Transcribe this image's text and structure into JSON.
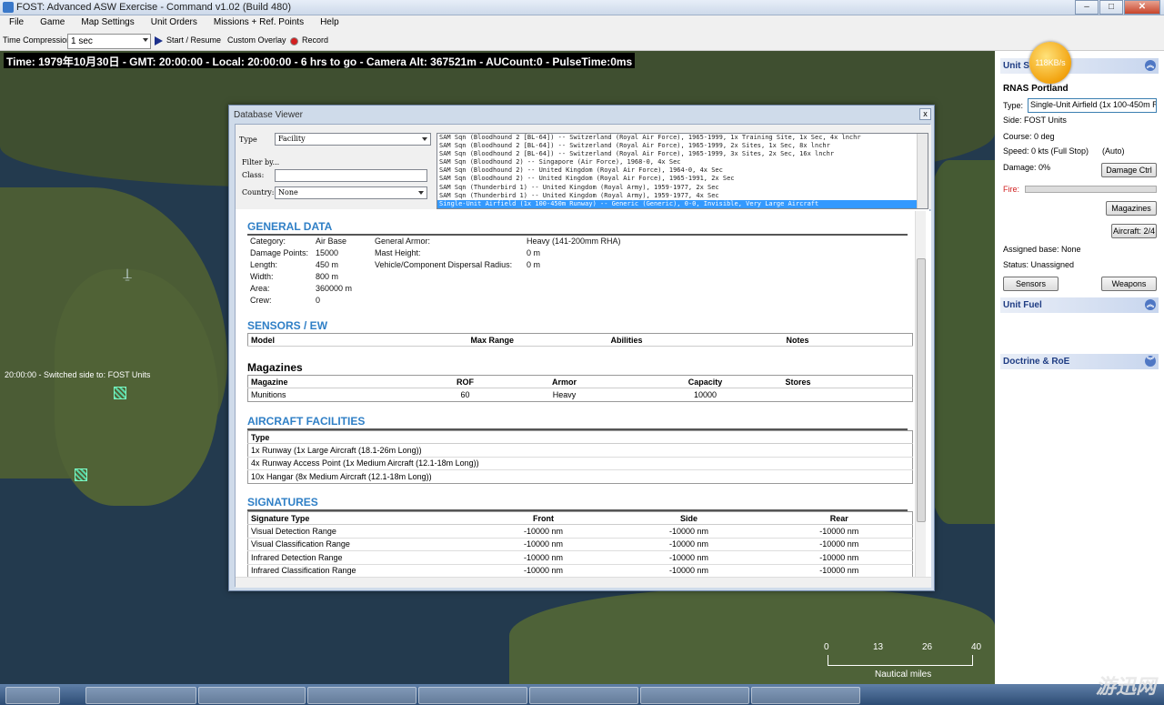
{
  "window": {
    "title": "FOST: Advanced ASW Exercise - Command v1.02 (Build 480)"
  },
  "menu": [
    "File",
    "Game",
    "Map Settings",
    "Unit Orders",
    "Missions + Ref. Points",
    "Help"
  ],
  "toolbar": {
    "time_compression_label": "Time Compression:",
    "time_compression_value": "1 sec",
    "start_label": "Start / Resume",
    "custom_overlay_label": "Custom Overlay",
    "record_label": "Record"
  },
  "map": {
    "status_line": "Time: 1979年10月30日 - GMT: 20:00:00 - Local: 20:00:00 - 6 hrs  to go -  Camera Alt: 367521m - AUCount:0 - PulseTime:0ms",
    "message": "20:00:00 - Switched side to: FOST Units",
    "scale": {
      "ticks": [
        "0",
        "13",
        "26",
        "40"
      ],
      "unit": "Nautical miles"
    }
  },
  "unit_panel": {
    "header": "Unit S",
    "badge": "118KB/s",
    "unit_name": "RNAS Portland",
    "type_label": "Type:",
    "type_value": "Single-Unit Airfield (1x 100-450m Run",
    "side": "Side: FOST Units",
    "course": "Course: 0 deg",
    "speed": "Speed: 0 kts (Full Stop)",
    "speed_mode": "(Auto)",
    "damage": "Damage: 0%",
    "damage_ctrl_btn": "Damage Ctrl",
    "fire_label": "Fire:",
    "magazines_btn": "Magazines",
    "aircraft_btn": "Aircraft: 2/4",
    "assigned_base": "Assigned base: None",
    "status": "Status: Unassigned",
    "sensors_btn": "Sensors",
    "weapons_btn": "Weapons",
    "fuel_header": "Unit Fuel",
    "doctrine_header": "Doctrine & RoE"
  },
  "db_viewer": {
    "title": "Database Viewer",
    "close": "x",
    "type_label": "Type",
    "type_value": "Facility",
    "filter_label": "Filter by...",
    "class_label": "Class:",
    "class_value": "",
    "country_label": "Country:",
    "country_value": "None",
    "results": [
      "SAM Sqn (Bloodhound 2 [BL-64]) -- Switzerland (Royal Air Force), 1965-1999, 1x Training Site, 1x Sec, 4x lnchr",
      "SAM Sqn (Bloodhound 2 [BL-64]) -- Switzerland (Royal Air Force), 1965-1999, 2x Sites, 1x Sec, 8x lnchr",
      "SAM Sqn (Bloodhound 2 [BL-64]) -- Switzerland (Royal Air Force), 1965-1999, 3x Sites, 2x Sec, 16x lnchr",
      "SAM Sqn (Bloodhound 2) -- Singapore (Air Force), 1968-0, 4x Sec",
      "SAM Sqn (Bloodhound 2) -- United Kingdom (Royal Air Force), 1964-0, 4x Sec",
      "SAM Sqn (Bloodhound 2) -- United Kingdom (Royal Air Force), 1965-1991, 2x Sec",
      "SAM Sqn (Thunderbird 1) -- United Kingdom (Royal Army), 1959-1977, 2x Sec",
      "SAM Sqn (Thunderbird 1) -- United Kingdom (Royal Army), 1959-1977, 4x Sec",
      "Single-Unit Airfield (1x 100-450m Runway) -- Generic (Generic), 0-0, Invisible, Very Large Aircraft"
    ],
    "general": {
      "header": "GENERAL DATA",
      "left": [
        {
          "k": "Category:",
          "v": "Air Base"
        },
        {
          "k": "Damage Points:",
          "v": "15000"
        },
        {
          "k": "Length:",
          "v": "450 m"
        },
        {
          "k": "Width:",
          "v": "800 m"
        },
        {
          "k": "Area:",
          "v": "360000 m"
        },
        {
          "k": "Crew:",
          "v": "0"
        }
      ],
      "right": [
        {
          "k": "General Armor:",
          "v": "Heavy (141-200mm RHA)"
        },
        {
          "k": "Mast Height:",
          "v": "0 m"
        },
        {
          "k": "Vehicle/Component Dispersal Radius:",
          "v": "0 m"
        }
      ]
    },
    "sensors": {
      "header": "SENSORS / EW",
      "cols": [
        "Model",
        "Max Range",
        "Abilities",
        "Notes"
      ]
    },
    "magazines": {
      "header": "Magazines",
      "cols": [
        "Magazine",
        "ROF",
        "Armor",
        "Capacity",
        "Stores"
      ],
      "rows": [
        [
          "Munitions",
          "60",
          "Heavy",
          "10000",
          ""
        ]
      ]
    },
    "aircraft": {
      "header": "AIRCRAFT FACILITIES",
      "cols": [
        "Type"
      ],
      "rows": [
        "1x Runway (1x Large Aircraft (18.1-26m Long))",
        "4x Runway Access Point (1x Medium Aircraft (12.1-18m Long))",
        "10x Hangar (8x Medium Aircraft (12.1-18m Long))"
      ]
    },
    "signatures": {
      "header": "SIGNATURES",
      "cols": [
        "Signature Type",
        "Front",
        "Side",
        "Rear"
      ],
      "rows": [
        [
          "Visual Detection Range",
          "-10000 nm",
          "-10000 nm",
          "-10000 nm"
        ],
        [
          "Visual Classification Range",
          "-10000 nm",
          "-10000 nm",
          "-10000 nm"
        ],
        [
          "Infrared Detection Range",
          "-10000 nm",
          "-10000 nm",
          "-10000 nm"
        ],
        [
          "Infrared Classification Range",
          "-10000 nm",
          "-10000 nm",
          "-10000 nm"
        ]
      ]
    }
  },
  "watermark": "游迅网"
}
